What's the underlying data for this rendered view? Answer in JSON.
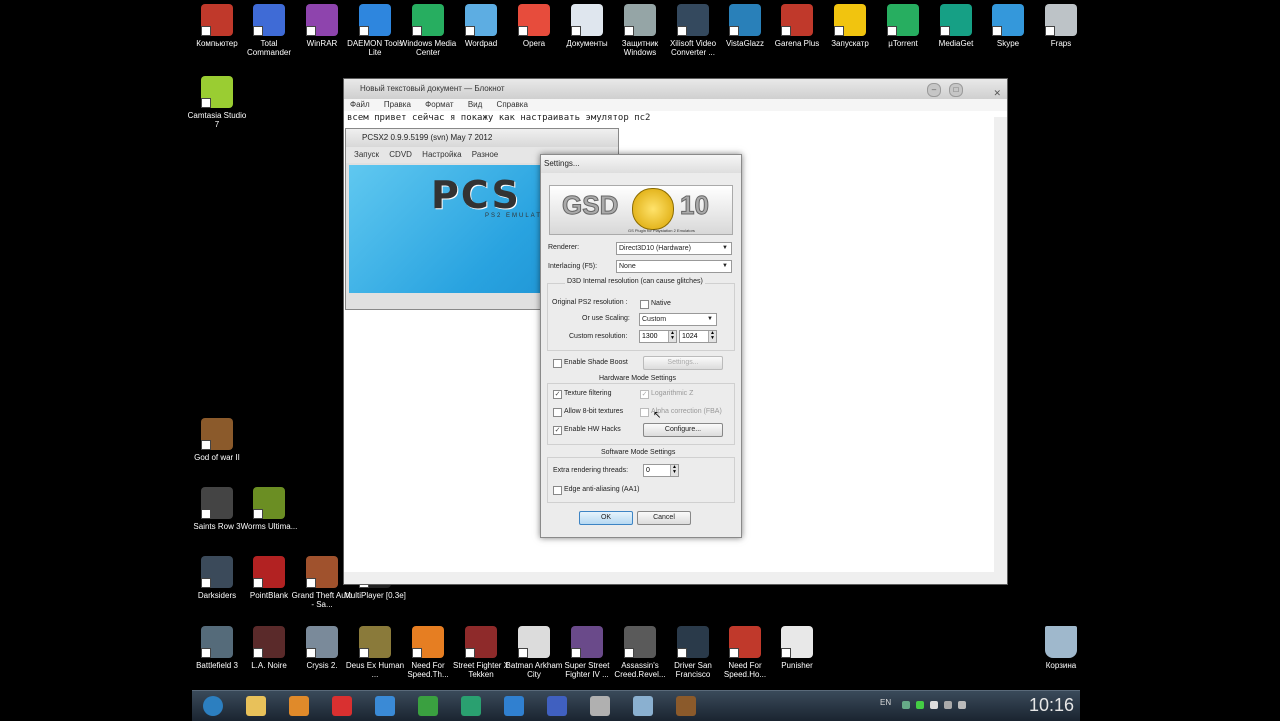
{
  "desktop": {
    "top_icons": [
      {
        "label": "Компьютер",
        "color": "#c0392b"
      },
      {
        "label": "Total Commander",
        "color": "#3f6bd6"
      },
      {
        "label": "WinRAR",
        "color": "#8e44ad"
      },
      {
        "label": "DAEMON Tools Lite",
        "color": "#2e86de"
      },
      {
        "label": "Windows Media Center",
        "color": "#27ae60"
      },
      {
        "label": "Wordpad",
        "color": "#5dade2"
      },
      {
        "label": "Opera",
        "color": "#e74c3c"
      },
      {
        "label": "Документы",
        "color": "#dfe6ee"
      },
      {
        "label": "Защитник Windows",
        "color": "#95a5a6"
      },
      {
        "label": "Xilisoft Video Converter ...",
        "color": "#34495e"
      },
      {
        "label": "VistaGlazz",
        "color": "#2980b9"
      },
      {
        "label": "Garena Plus",
        "color": "#c0392b"
      },
      {
        "label": "Запускатр",
        "color": "#f1c40f"
      },
      {
        "label": "µTorrent",
        "color": "#27ae60"
      },
      {
        "label": "MediaGet",
        "color": "#16a085"
      },
      {
        "label": "Skype",
        "color": "#3498db"
      },
      {
        "label": "Fraps",
        "color": "#bdc3c7"
      }
    ],
    "left_icons": [
      {
        "label": "Camtasia Studio 7",
        "color": "#9acd32"
      },
      {
        "label": "God of war II",
        "color": "#8b5a2b"
      },
      {
        "label": "Saints Row 3",
        "color": "#444444"
      },
      {
        "label": "Worms Ultima...",
        "color": "#6b8e23"
      },
      {
        "label": "Darksiders",
        "color": "#3b4a5a"
      },
      {
        "label": "PointBlank",
        "color": "#b22222"
      },
      {
        "label": "Grand Theft Auto - Sa...",
        "color": "#a0522d"
      },
      {
        "label": "MultiPlayer [0.3e]",
        "color": "#222222"
      }
    ],
    "bottom_icons": [
      {
        "label": "Battlefield 3",
        "color": "#556b7a"
      },
      {
        "label": "L.A. Noire",
        "color": "#5a2a2a"
      },
      {
        "label": "Crysis 2.",
        "color": "#7a8a9a"
      },
      {
        "label": "Deus Ex Human ...",
        "color": "#8a7a3a"
      },
      {
        "label": "Need For Speed.Th...",
        "color": "#e67e22"
      },
      {
        "label": "Street Fighter X Tekken",
        "color": "#8e2a2a"
      },
      {
        "label": "Batman Arkham City",
        "color": "#dcdcdc"
      },
      {
        "label": "Super Street Fighter IV ...",
        "color": "#6a4a8a"
      },
      {
        "label": "Assassin's Creed.Revel...",
        "color": "#5a5a5a"
      },
      {
        "label": "Driver San Francisco",
        "color": "#2a3a4a"
      },
      {
        "label": "Need For Speed.Ho...",
        "color": "#c0392b"
      },
      {
        "label": "Punisher",
        "color": "#e8e8e8"
      }
    ],
    "recycle": {
      "label": "Корзина",
      "color": "#9fb8cc"
    }
  },
  "notepad": {
    "title": "Новый текстовый документ — Блокнот",
    "menu": [
      "Файл",
      "Правка",
      "Формат",
      "Вид",
      "Справка"
    ],
    "text": "всем привет сейчас я покажу как настраивать эмулятор пс2"
  },
  "pcsx2": {
    "title": "PCSX2  0.9.9.5199 (svn)  May  7 2012",
    "menu": [
      "Запуск",
      "CDVD",
      "Настройка",
      "Разное"
    ],
    "logo": "PCS",
    "logo_sub": "PS2 EMULAT"
  },
  "settings": {
    "title": "Settings...",
    "logo_left": "GSD",
    "logo_right": "10",
    "logo_caption": "GS Plugin  for Playstation 2 Emulators",
    "renderer_label": "Renderer:",
    "renderer_value": "Direct3D10 (Hardware)",
    "interlacing_label": "Interlacing (F5):",
    "interlacing_value": "None",
    "d3d_group": "D3D Internal resolution (can cause glitches)",
    "orig_label": "Original PS2 resolution :",
    "native_label": "Native",
    "scaling_label": "Or use Scaling:",
    "scaling_value": "Custom",
    "custom_label": "Custom resolution:",
    "res_w": "1300",
    "res_h": "1024",
    "shade_label": "Enable Shade Boost",
    "shade_btn": "Settings...",
    "hw_group": "Hardware Mode Settings",
    "tex_filter": "Texture filtering",
    "logz": "Logarithmic Z",
    "allow8": "Allow 8-bit textures",
    "alpha": "Alpha correction (FBA)",
    "hwhacks": "Enable HW Hacks",
    "configure_btn": "Configure...",
    "sw_group": "Software Mode Settings",
    "threads_label": "Extra rendering threads:",
    "threads_value": "0",
    "aa_label": "Edge anti-aliasing (AA1)",
    "ok": "OK",
    "cancel": "Cancel"
  },
  "taskbar": {
    "apps": [
      {
        "name": "start",
        "color": "#2c7fc0"
      },
      {
        "name": "explorer",
        "color": "#e8c15a"
      },
      {
        "name": "media-player",
        "color": "#e08a2a"
      },
      {
        "name": "opera",
        "color": "#d93030"
      },
      {
        "name": "internet-explorer",
        "color": "#3a8ad6"
      },
      {
        "name": "utorrent",
        "color": "#3aa040"
      },
      {
        "name": "mediaget",
        "color": "#2aa070"
      },
      {
        "name": "daemon-tools",
        "color": "#3080d0"
      },
      {
        "name": "total-commander",
        "color": "#4060c0"
      },
      {
        "name": "fraps",
        "color": "#b0b0b0"
      },
      {
        "name": "notepad",
        "color": "#8ab0d0"
      },
      {
        "name": "god-of-war",
        "color": "#8b5a2b"
      }
    ],
    "lang": "EN",
    "clock": "10:16"
  }
}
